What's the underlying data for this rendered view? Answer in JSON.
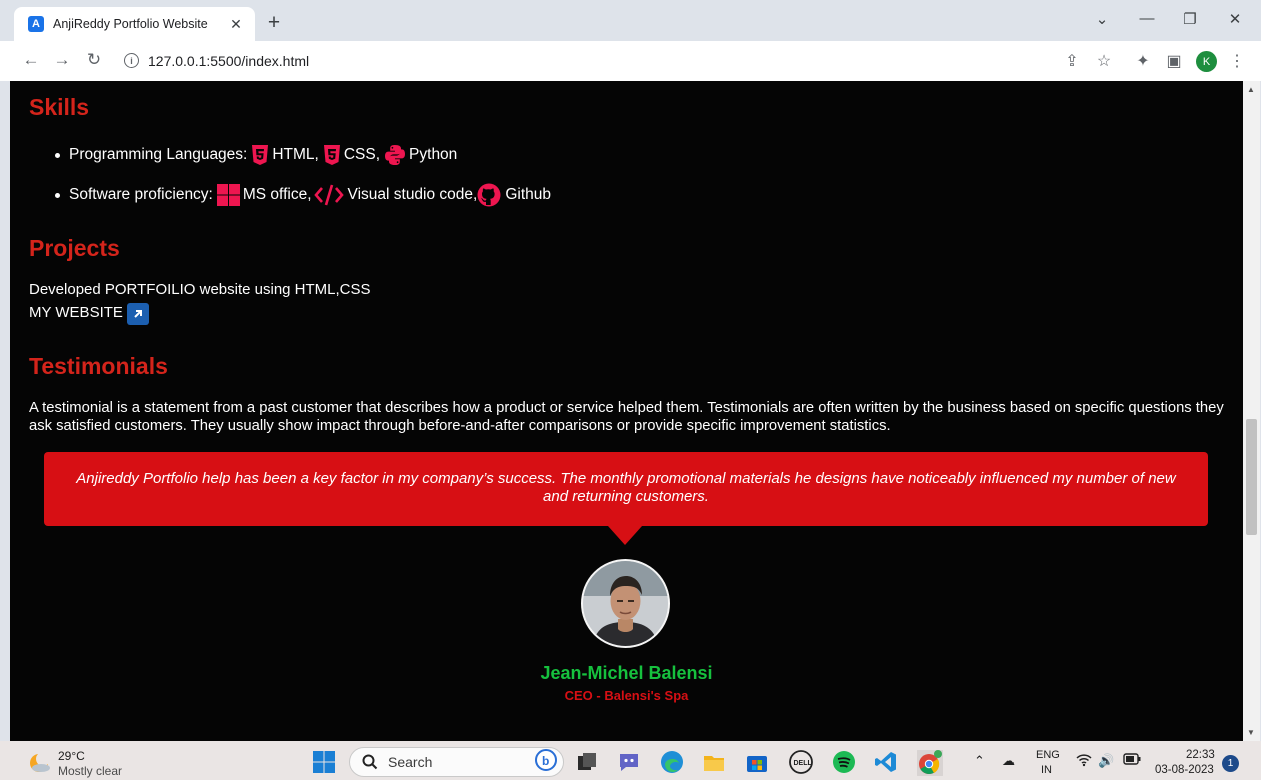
{
  "browser": {
    "tab_title": "AnjiReddy Portfolio Website",
    "favicon_letter": "A",
    "url": "127.0.0.1:5500/index.html",
    "profile_initial": "K"
  },
  "page": {
    "skills": {
      "heading": "Skills",
      "languages_label": "Programming Languages:",
      "lang_html": "HTML,",
      "lang_css": "CSS,",
      "lang_python": "Python",
      "software_label": "Software proficiency:",
      "sw_office": "MS office,",
      "sw_vscode": "Visual studio code,",
      "sw_github": "Github"
    },
    "projects": {
      "heading": "Projects",
      "line1": "Developed PORTFOILIO website using HTML,CSS",
      "link": "MY WEBSITE"
    },
    "testimonials": {
      "heading": "Testimonials",
      "description": "A testimonial is a statement from a past customer that describes how a product or service helped them. Testimonials are often written by the business based on specific questions they ask satisfied customers. They usually show impact through before-and-after comparisons or provide specific improvement statistics.",
      "quote": "Anjireddy Portfolio help has been a key factor in my company’s success. The monthly promotional materials he designs have noticeably influenced my number of new and returning customers.",
      "name": "Jean-Michel Balensi",
      "role": "CEO - Balensi's Spa"
    }
  },
  "taskbar": {
    "temperature": "29°C",
    "weather": "Mostly clear",
    "search_label": "Search",
    "lang_line1": "ENG",
    "lang_line2": "IN",
    "time": "22:33",
    "date": "03-08-2023",
    "notifications": "1"
  },
  "colors": {
    "heading_red": "#d4241b",
    "icon_pink": "#ee1650",
    "quote_red": "#d70f14",
    "name_green": "#16c13e"
  }
}
